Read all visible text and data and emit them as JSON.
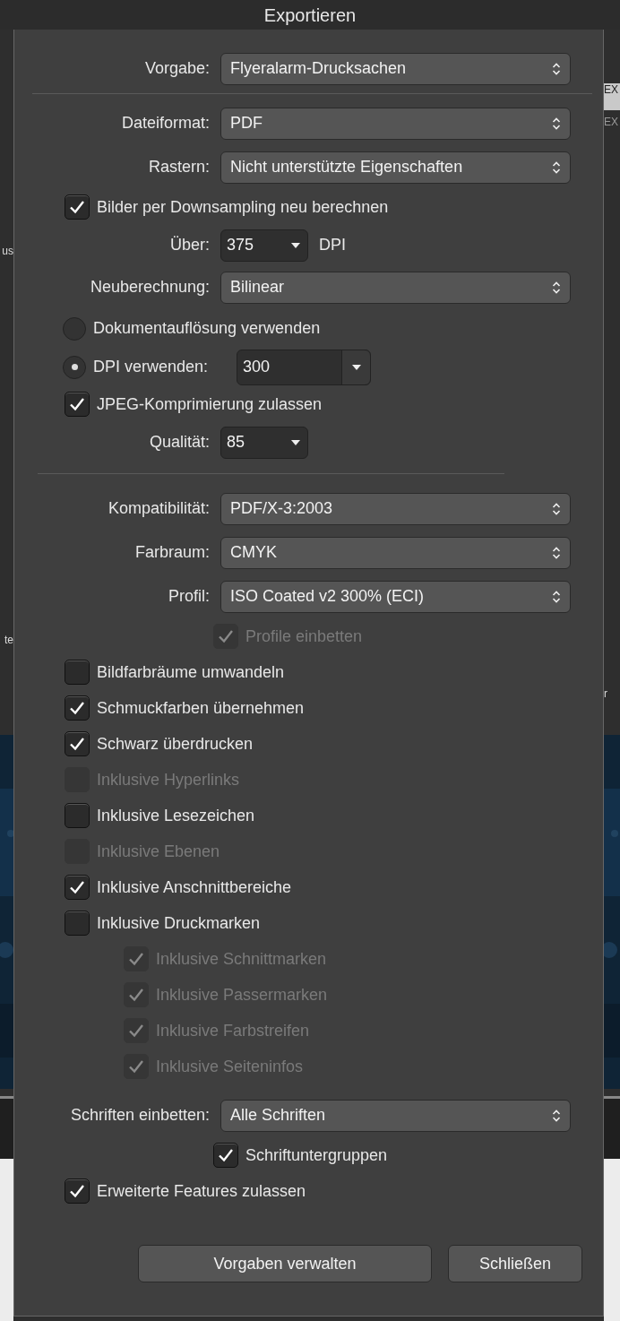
{
  "window": {
    "title": "Exportieren"
  },
  "background_left": [
    "us",
    "te"
  ],
  "background_right": [
    "EX",
    "EX",
    "r"
  ],
  "rows": [
    {
      "kind": "select",
      "label": "Vorgabe:",
      "value": "Flyeralarm-Drucksachen"
    },
    {
      "kind": "divider"
    },
    {
      "kind": "select",
      "label": "Dateiformat:",
      "value": "PDF"
    },
    {
      "kind": "select",
      "label": "Rastern:",
      "value": "Nicht unterstützte Eigenschaften"
    },
    {
      "kind": "checkbox",
      "label": "Bilder per Downsampling neu berechnen",
      "checked": true,
      "disabled": false
    },
    {
      "kind": "combo",
      "label": "Über:",
      "value": "375",
      "suffix": "DPI"
    },
    {
      "kind": "select",
      "label": "Neuberechnung:",
      "value": "Bilinear"
    },
    {
      "kind": "radio",
      "label": "Dokumentauflösung verwenden",
      "selected": false
    },
    {
      "kind": "radio",
      "label": "DPI verwenden:",
      "selected": true,
      "value": "300"
    },
    {
      "kind": "checkbox",
      "label": "JPEG-Komprimierung zulassen",
      "checked": true,
      "disabled": false
    },
    {
      "kind": "combo",
      "label": "Qualität:",
      "value": "85"
    },
    {
      "kind": "divider"
    },
    {
      "kind": "select",
      "label": "Kompatibilität:",
      "value": "PDF/X-3:2003"
    },
    {
      "kind": "select",
      "label": "Farbraum:",
      "value": "CMYK"
    },
    {
      "kind": "select",
      "label": "Profil:",
      "value": "ISO Coated v2 300% (ECI)",
      "children": [
        {
          "kind": "checkbox",
          "label": "Profile einbetten",
          "checked": true,
          "disabled": true
        }
      ]
    },
    {
      "kind": "checkbox",
      "label": "Bildfarbräume umwandeln",
      "checked": false,
      "disabled": false
    },
    {
      "kind": "checkbox",
      "label": "Schmuckfarben übernehmen",
      "checked": true,
      "disabled": false
    },
    {
      "kind": "checkbox",
      "label": "Schwarz überdrucken",
      "checked": true,
      "disabled": false
    },
    {
      "kind": "checkbox",
      "label": "Inklusive Hyperlinks",
      "checked": false,
      "disabled": true
    },
    {
      "kind": "checkbox",
      "label": "Inklusive Lesezeichen",
      "checked": false,
      "disabled": false
    },
    {
      "kind": "checkbox",
      "label": "Inklusive Ebenen",
      "checked": false,
      "disabled": true
    },
    {
      "kind": "checkbox",
      "label": "Inklusive Anschnittbereiche",
      "checked": true,
      "disabled": false
    },
    {
      "kind": "checkbox",
      "label": "Inklusive Druckmarken",
      "checked": false,
      "disabled": false,
      "children": [
        {
          "kind": "checkbox",
          "label": "Inklusive Schnittmarken",
          "checked": true,
          "disabled": true
        },
        {
          "kind": "checkbox",
          "label": "Inklusive Passermarken",
          "checked": true,
          "disabled": true
        },
        {
          "kind": "checkbox",
          "label": "Inklusive Farbstreifen",
          "checked": true,
          "disabled": true
        },
        {
          "kind": "checkbox",
          "label": "Inklusive Seiteninfos",
          "checked": true,
          "disabled": true
        }
      ]
    },
    {
      "kind": "select",
      "label": "Schriften einbetten:",
      "value": "Alle Schriften",
      "children": [
        {
          "kind": "checkbox",
          "label": "Schriftuntergruppen",
          "checked": true,
          "disabled": false
        }
      ]
    },
    {
      "kind": "checkbox",
      "label": "Erweiterte Features zulassen",
      "checked": true,
      "disabled": false
    }
  ],
  "buttons": [
    "Vorgaben verwalten",
    "Schließen"
  ]
}
